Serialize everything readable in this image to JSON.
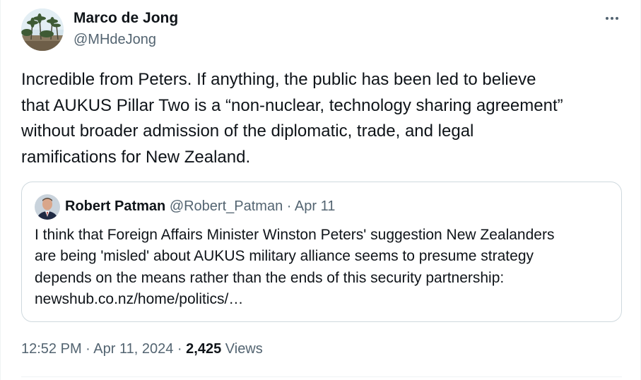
{
  "tweet": {
    "author": {
      "name": "Marco de Jong",
      "handle": "@MHdeJong"
    },
    "more_icon": "more-horizontal-icon",
    "body_lines": [
      "Incredible from Peters. If anything, the public has been led to believe",
      "that AUKUS Pillar Two is a “non-nuclear, technology sharing agreement”",
      "without broader admission of the diplomatic, trade, and legal",
      "ramifications for New Zealand."
    ],
    "quote": {
      "author_name": "Robert Patman",
      "author_handle": "@Robert_Patman",
      "separator": "·",
      "date": "Apr 11",
      "text_lines": [
        "I think that Foreign Affairs Minister Winston Peters' suggestion New Zealanders",
        "are being 'misled' about AUKUS military alliance seems to presume strategy",
        "depends on the means rather than the ends of this security partnership:",
        "newshub.co.nz/home/politics/…"
      ]
    },
    "meta": {
      "time": "12:52 PM",
      "separator": "·",
      "date": "Apr 11, 2024",
      "views_count": "2,425",
      "views_label": "Views"
    }
  },
  "colors": {
    "text_primary": "#0f1419",
    "text_secondary": "#536471",
    "border": "#cfd9de"
  }
}
